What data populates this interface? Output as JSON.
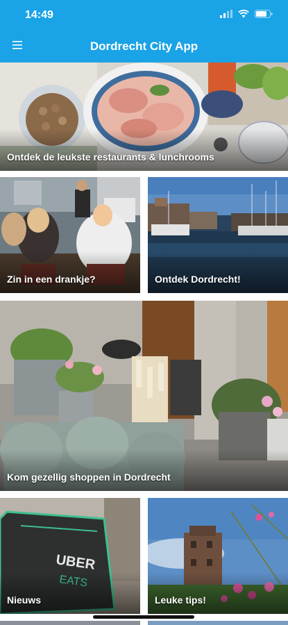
{
  "status": {
    "time": "14:49"
  },
  "appbar": {
    "title": "Dordrecht City App"
  },
  "tiles": [
    {
      "label": "Ontdek de leukste restaurants & lunchrooms"
    },
    {
      "label": "Zin in een drankje?"
    },
    {
      "label": "Ontdek Dordrecht!"
    },
    {
      "label": "Kom gezellig shoppen in Dordrecht"
    },
    {
      "label": "Nieuws"
    },
    {
      "label": "Leuke tips!"
    }
  ],
  "colors": {
    "accent": "#1aa3e6"
  }
}
